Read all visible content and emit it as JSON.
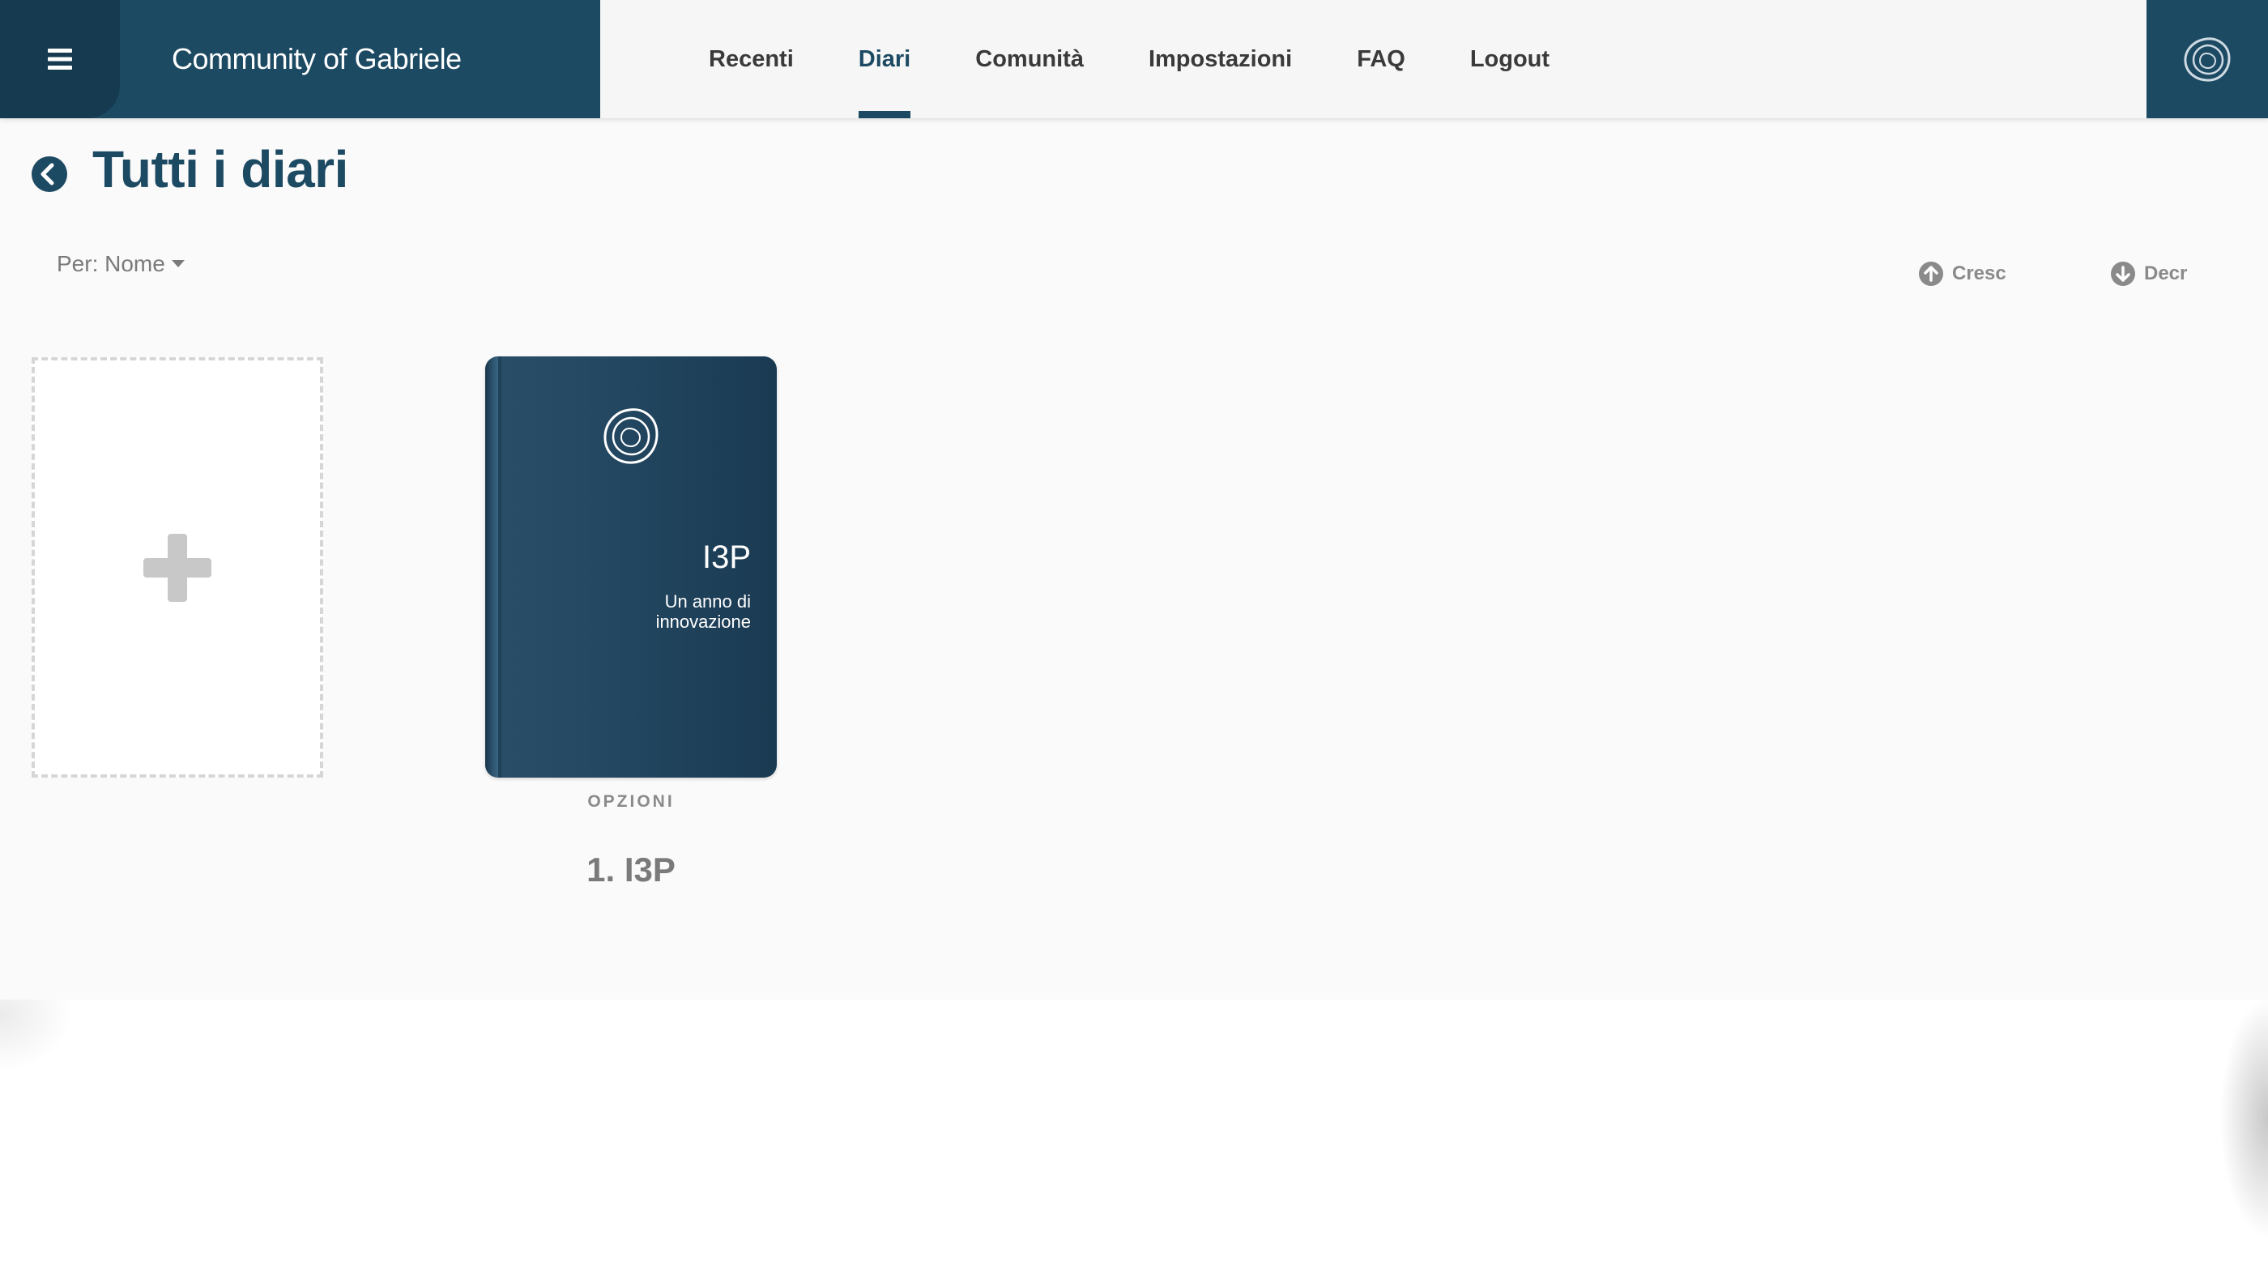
{
  "app": {
    "brand_title": "Community of Gabriele",
    "menu_icon": "hamburger-menu-icon",
    "logo_icon": "gabriele-logo-icon",
    "accent_color": "#1d4a63"
  },
  "nav": {
    "items": [
      {
        "label": "Recenti",
        "active": false
      },
      {
        "label": "Diari",
        "active": true
      },
      {
        "label": "Comunità",
        "active": false
      },
      {
        "label": "Impostazioni",
        "active": false
      },
      {
        "label": "FAQ",
        "active": false
      },
      {
        "label": "Logout",
        "active": false
      }
    ]
  },
  "page": {
    "title": "Tutti i diari",
    "back_icon": "back-circle-icon"
  },
  "sort": {
    "by_label": "Per: Nome",
    "asc_label": "Cresc",
    "desc_label": "Decr"
  },
  "add_card": {
    "icon": "plus-icon"
  },
  "diaries": [
    {
      "cover_title": "I3P",
      "cover_subtitle": "Un anno di innovazione",
      "options_label": "OPZIONI",
      "name": "1. I3P"
    }
  ]
}
